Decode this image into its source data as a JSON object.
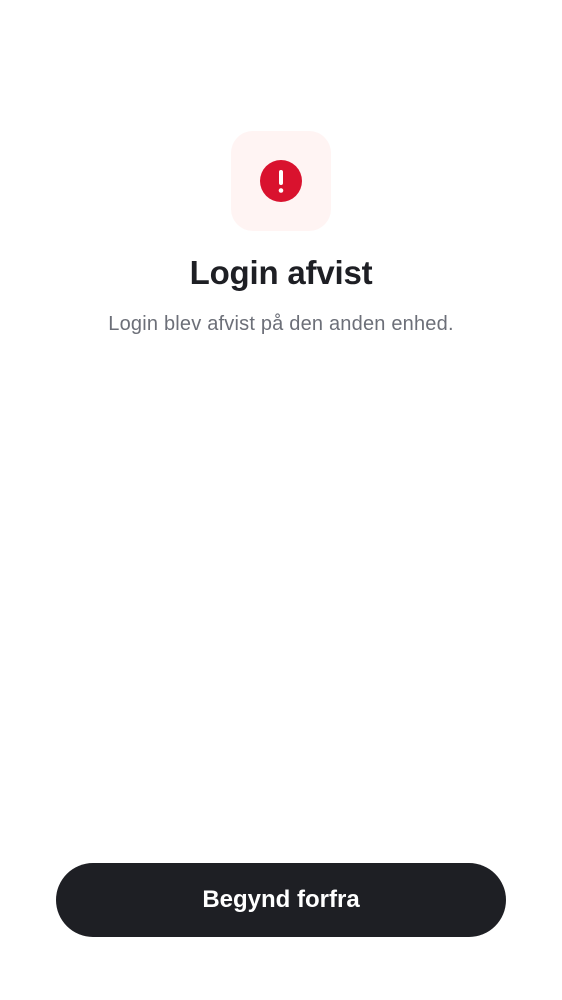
{
  "status": {
    "icon": "alert-circle-icon",
    "icon_color": "#d9122e",
    "tile_color": "#fff4f3"
  },
  "content": {
    "title": "Login afvist",
    "message": "Login blev afvist på den anden enhed."
  },
  "actions": {
    "restart_label": "Begynd forfra"
  },
  "colors": {
    "button_background": "#1e1f24",
    "title_text": "#1e1f24",
    "message_text": "#6c6f78"
  }
}
